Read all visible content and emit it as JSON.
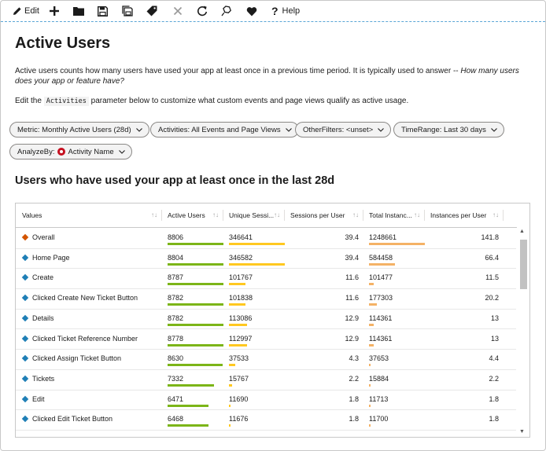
{
  "toolbar": {
    "edit_label": "Edit",
    "help_label": "Help",
    "icons": [
      "edit-icon",
      "add-icon",
      "folder-icon",
      "save-icon",
      "save-as-icon",
      "tag-icon",
      "close-icon",
      "refresh-icon",
      "pin-icon",
      "heart-icon",
      "help-icon"
    ]
  },
  "page": {
    "title": "Active Users",
    "desc_text": "Active users counts how many users have used your app at least once in a previous time period. It is typically used to answer -- ",
    "desc_em": "How many users does your app or feature have?",
    "edit_prefix": "Edit the",
    "edit_code": "Activities",
    "edit_suffix": "parameter below to customize what custom events and page views qualify as active usage."
  },
  "params": {
    "metric": "Metric: Monthly Active Users (28d)",
    "activities": "Activities: All Events and Page Views",
    "other_filters": "OtherFilters: <unset>",
    "time_range": "TimeRange: Last 30 days",
    "analyze_by_prefix": "AnalyzeBy:",
    "analyze_by_value": "Activity Name"
  },
  "section": {
    "title": "Users who have used your app at least once in the last 28d"
  },
  "grid": {
    "columns": [
      "Values",
      "Active Users",
      "Unique Sessi...",
      "Sessions per User",
      "Total Instanc...",
      "Instances per User"
    ],
    "rows": [
      {
        "name": "Overall",
        "active_users": "8806",
        "unique_sessions": "346641",
        "sessions_per_user": "39.4",
        "total_instances": "1248661",
        "instances_per_user": "141.8",
        "au_frac": 1.0,
        "us_frac": 1.0,
        "ti_frac": 1.0,
        "marker": "#d35400"
      },
      {
        "name": "Home Page",
        "active_users": "8804",
        "unique_sessions": "346582",
        "sessions_per_user": "39.4",
        "total_instances": "584458",
        "instances_per_user": "66.4",
        "au_frac": 1.0,
        "us_frac": 1.0,
        "ti_frac": 0.47,
        "marker": "#1f7fb6"
      },
      {
        "name": "Create",
        "active_users": "8787",
        "unique_sessions": "101767",
        "sessions_per_user": "11.6",
        "total_instances": "101477",
        "instances_per_user": "11.5",
        "au_frac": 1.0,
        "us_frac": 0.29,
        "ti_frac": 0.08,
        "marker": "#1f7fb6"
      },
      {
        "name": "Clicked Create New Ticket Button",
        "active_users": "8782",
        "unique_sessions": "101838",
        "sessions_per_user": "11.6",
        "total_instances": "177303",
        "instances_per_user": "20.2",
        "au_frac": 1.0,
        "us_frac": 0.29,
        "ti_frac": 0.14,
        "marker": "#1f7fb6"
      },
      {
        "name": "Details",
        "active_users": "8782",
        "unique_sessions": "113086",
        "sessions_per_user": "12.9",
        "total_instances": "114361",
        "instances_per_user": "13",
        "au_frac": 1.0,
        "us_frac": 0.33,
        "ti_frac": 0.09,
        "marker": "#1f7fb6"
      },
      {
        "name": "Clicked Ticket Reference Number",
        "active_users": "8778",
        "unique_sessions": "112997",
        "sessions_per_user": "12.9",
        "total_instances": "114361",
        "instances_per_user": "13",
        "au_frac": 1.0,
        "us_frac": 0.33,
        "ti_frac": 0.09,
        "marker": "#1f7fb6"
      },
      {
        "name": "Clicked Assign Ticket Button",
        "active_users": "8630",
        "unique_sessions": "37533",
        "sessions_per_user": "4.3",
        "total_instances": "37653",
        "instances_per_user": "4.4",
        "au_frac": 0.98,
        "us_frac": 0.11,
        "ti_frac": 0.03,
        "marker": "#1f7fb6"
      },
      {
        "name": "Tickets",
        "active_users": "7332",
        "unique_sessions": "15767",
        "sessions_per_user": "2.2",
        "total_instances": "15884",
        "instances_per_user": "2.2",
        "au_frac": 0.83,
        "us_frac": 0.05,
        "ti_frac": 0.01,
        "marker": "#1f7fb6"
      },
      {
        "name": "Edit",
        "active_users": "6471",
        "unique_sessions": "11690",
        "sessions_per_user": "1.8",
        "total_instances": "11713",
        "instances_per_user": "1.8",
        "au_frac": 0.73,
        "us_frac": 0.03,
        "ti_frac": 0.01,
        "marker": "#1f7fb6"
      },
      {
        "name": "Clicked Edit Ticket Button",
        "active_users": "6468",
        "unique_sessions": "11676",
        "sessions_per_user": "1.8",
        "total_instances": "11700",
        "instances_per_user": "1.8",
        "au_frac": 0.73,
        "us_frac": 0.03,
        "ti_frac": 0.01,
        "marker": "#1f7fb6"
      }
    ]
  },
  "colors": {
    "green_bar": "#7cb518",
    "yellow_bar": "#ffc820",
    "orange_bar": "#f4b266",
    "overall_marker": "#d35400",
    "row_marker": "#1f7fb6",
    "toolbar_border": "#5aa6d6"
  }
}
